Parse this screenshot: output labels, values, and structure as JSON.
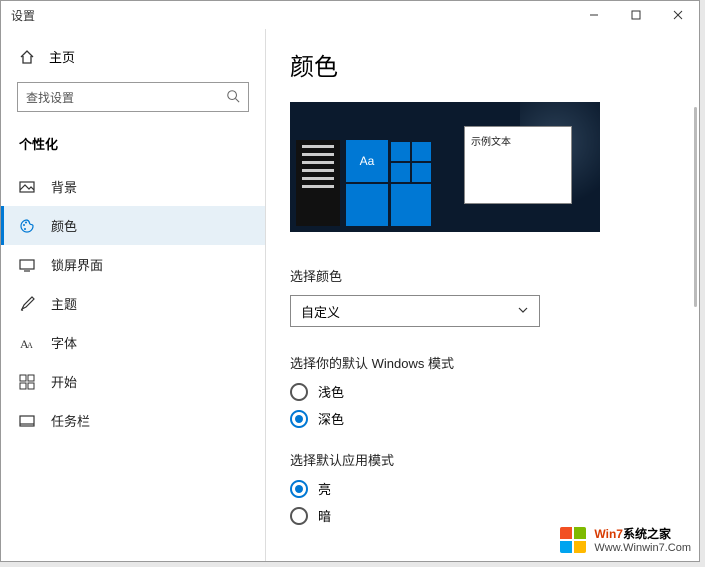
{
  "window": {
    "title": "设置"
  },
  "sidebar": {
    "home_label": "主页",
    "search_placeholder": "查找设置",
    "section_title": "个性化",
    "items": [
      {
        "label": "背景"
      },
      {
        "label": "颜色"
      },
      {
        "label": "锁屏界面"
      },
      {
        "label": "主题"
      },
      {
        "label": "字体"
      },
      {
        "label": "开始"
      },
      {
        "label": "任务栏"
      }
    ]
  },
  "main": {
    "title": "颜色",
    "preview_sample_text": "示例文本",
    "preview_aa": "Aa",
    "choose_color_label": "选择颜色",
    "choose_color_value": "自定义",
    "windows_mode_label": "选择你的默认 Windows 模式",
    "windows_mode_options": {
      "light": "浅色",
      "dark": "深色"
    },
    "app_mode_label": "选择默认应用模式",
    "app_mode_options": {
      "light": "亮",
      "dark": "暗"
    }
  },
  "watermark": {
    "line1_brand": "Win7",
    "line1_rest": "系统之家",
    "line2": "Www.Winwin7.Com"
  }
}
